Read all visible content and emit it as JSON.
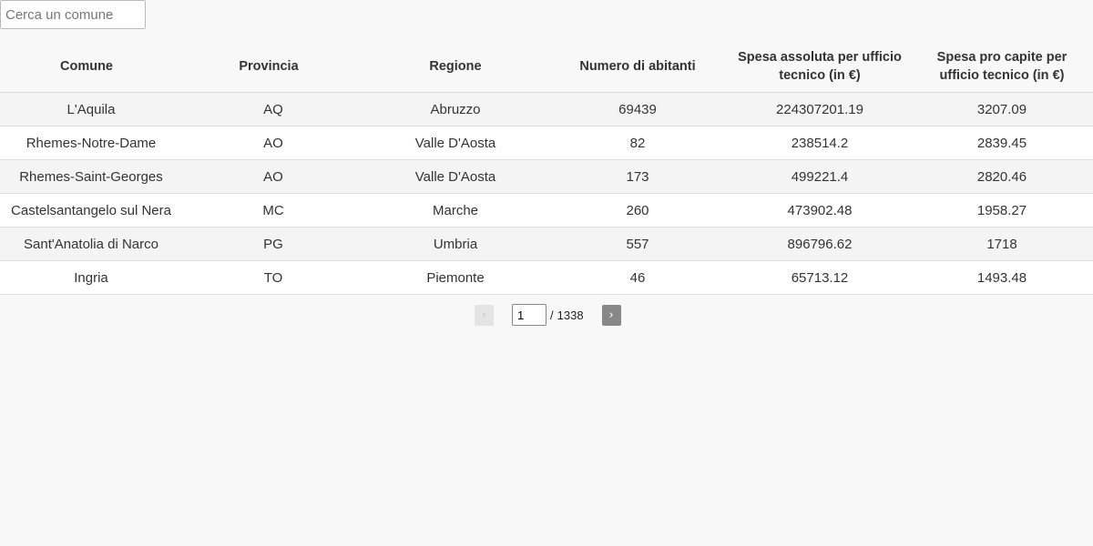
{
  "search": {
    "placeholder": "Cerca un comune",
    "value": ""
  },
  "table": {
    "headers": [
      "Comune",
      "Provincia",
      "Regione",
      "Numero di abitanti",
      "Spesa assoluta per ufficio tecnico (in €)",
      "Spesa pro capite per ufficio tecnico (in €)"
    ],
    "rows": [
      [
        "L'Aquila",
        "AQ",
        "Abruzzo",
        "69439",
        "224307201.19",
        "3207.09"
      ],
      [
        "Rhemes-Notre-Dame",
        "AO",
        "Valle D'Aosta",
        "82",
        "238514.2",
        "2839.45"
      ],
      [
        "Rhemes-Saint-Georges",
        "AO",
        "Valle D'Aosta",
        "173",
        "499221.4",
        "2820.46"
      ],
      [
        "Castelsantangelo sul Nera",
        "MC",
        "Marche",
        "260",
        "473902.48",
        "1958.27"
      ],
      [
        "Sant'Anatolia di Narco",
        "PG",
        "Umbria",
        "557",
        "896796.62",
        "1718"
      ],
      [
        "Ingria",
        "TO",
        "Piemonte",
        "46",
        "65713.12",
        "1493.48"
      ]
    ]
  },
  "pagination": {
    "prev_label": "‹",
    "next_label": "›",
    "current_page": "1",
    "separator": "/",
    "total_pages": "1338"
  }
}
